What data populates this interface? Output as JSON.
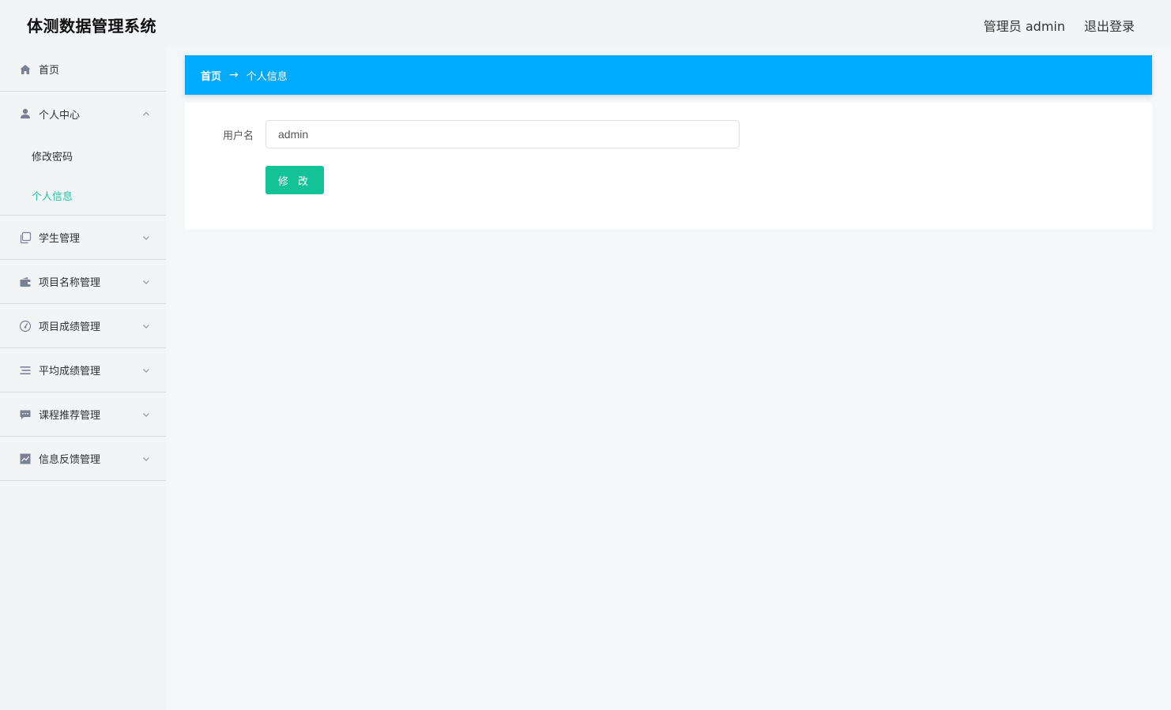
{
  "header": {
    "title": "体测数据管理系统",
    "user_info": "管理员 admin",
    "logout_label": "退出登录"
  },
  "sidebar": {
    "home": {
      "label": "首页",
      "icon": "home-icon"
    },
    "personal": {
      "label": "个人中心",
      "icon": "user-icon",
      "expanded": true,
      "children": [
        {
          "label": "修改密码",
          "active": false
        },
        {
          "label": "个人信息",
          "active": true
        }
      ]
    },
    "items": [
      {
        "label": "学生管理",
        "icon": "copy-icon"
      },
      {
        "label": "项目名称管理",
        "icon": "wallet-icon"
      },
      {
        "label": "项目成绩管理",
        "icon": "gauge-icon"
      },
      {
        "label": "平均成绩管理",
        "icon": "list-icon"
      },
      {
        "label": "课程推荐管理",
        "icon": "chat-icon"
      },
      {
        "label": "信息反馈管理",
        "icon": "chart-icon"
      }
    ]
  },
  "breadcrumb": {
    "home": "首页",
    "arrow": "→",
    "current": "个人信息"
  },
  "form": {
    "username_label": "用户名",
    "username_value": "admin",
    "submit_label": "修 改"
  },
  "colors": {
    "accent": "#00aaff",
    "active_menu": "#27c3a0",
    "button": "#13c296"
  }
}
